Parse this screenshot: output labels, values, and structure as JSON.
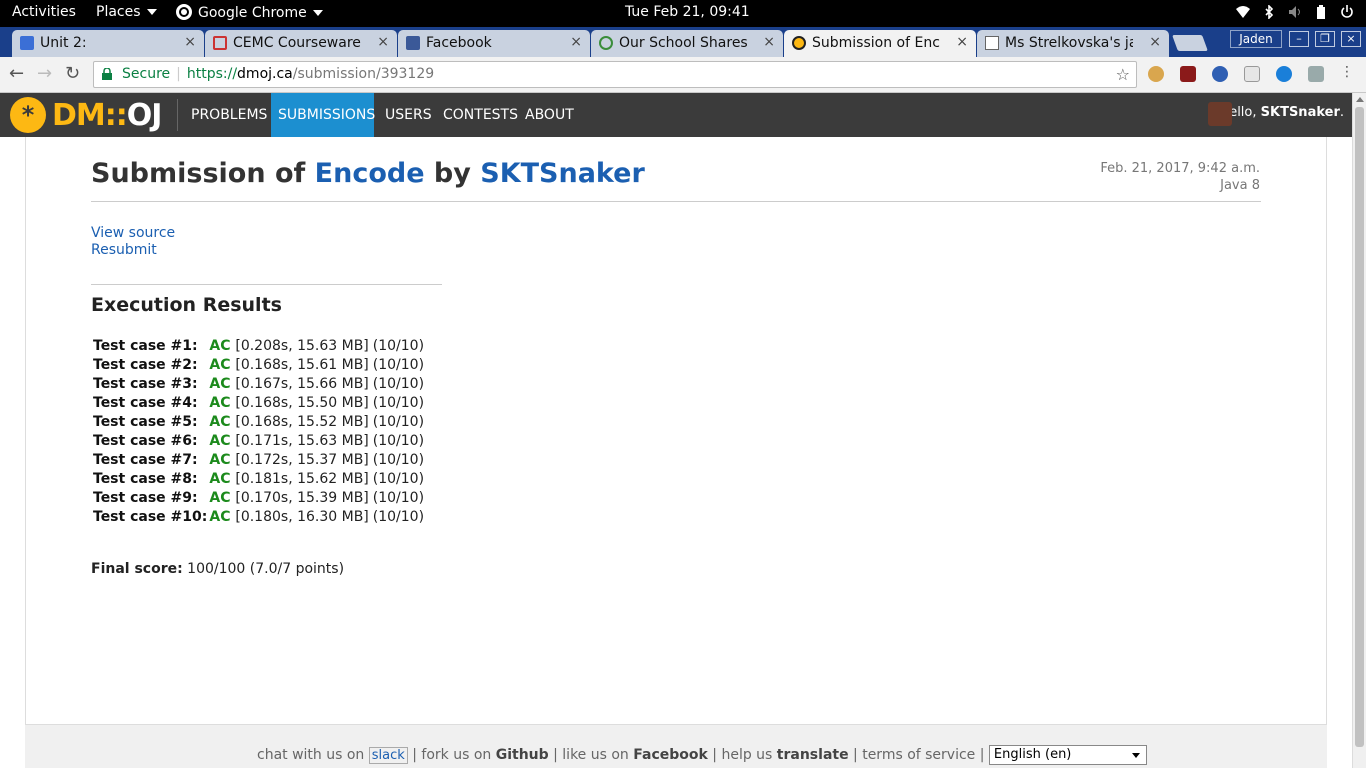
{
  "system_bar": {
    "activities": "Activities",
    "places": "Places",
    "app": "Google Chrome",
    "clock": "Tue Feb 21, 09:41"
  },
  "browser": {
    "tabs": [
      {
        "title": "Unit 2:"
      },
      {
        "title": "CEMC Courseware - M"
      },
      {
        "title": "Facebook"
      },
      {
        "title": "Our School Shares"
      },
      {
        "title": "Submission of Encode"
      },
      {
        "title": "Ms Strelkovska's java"
      }
    ],
    "profile": "Jaden",
    "security_label": "Secure",
    "url_scheme": "https://",
    "url_host": "dmoj.ca",
    "url_path": "/submission/393129"
  },
  "site": {
    "logo_dm": "DM",
    "logo_sep": "::",
    "logo_oj": "OJ",
    "nav": [
      "PROBLEMS",
      "SUBMISSIONS",
      "USERS",
      "CONTESTS",
      "ABOUT"
    ],
    "greeting_prefix": "Hello, ",
    "username": "SKTSnaker",
    "greeting_suffix": "."
  },
  "submission": {
    "title_prefix": "Submission of ",
    "problem": "Encode",
    "title_by": " by ",
    "author": "SKTSnaker",
    "date": "Feb. 21, 2017, 9:42 a.m.",
    "language": "Java 8",
    "view_source": "View source",
    "resubmit": "Resubmit",
    "execution_title": "Execution Results",
    "test_cases": [
      {
        "label": "Test case #1:",
        "status": "AC",
        "resources": "[0.208s, 15.63 MB]",
        "points": "(10/10)"
      },
      {
        "label": "Test case #2:",
        "status": "AC",
        "resources": "[0.168s, 15.61 MB]",
        "points": "(10/10)"
      },
      {
        "label": "Test case #3:",
        "status": "AC",
        "resources": "[0.167s, 15.66 MB]",
        "points": "(10/10)"
      },
      {
        "label": "Test case #4:",
        "status": "AC",
        "resources": "[0.168s, 15.50 MB]",
        "points": "(10/10)"
      },
      {
        "label": "Test case #5:",
        "status": "AC",
        "resources": "[0.168s, 15.52 MB]",
        "points": "(10/10)"
      },
      {
        "label": "Test case #6:",
        "status": "AC",
        "resources": "[0.171s, 15.63 MB]",
        "points": "(10/10)"
      },
      {
        "label": "Test case #7:",
        "status": "AC",
        "resources": "[0.172s, 15.37 MB]",
        "points": "(10/10)"
      },
      {
        "label": "Test case #8:",
        "status": "AC",
        "resources": "[0.181s, 15.62 MB]",
        "points": "(10/10)"
      },
      {
        "label": "Test case #9:",
        "status": "AC",
        "resources": "[0.170s, 15.39 MB]",
        "points": "(10/10)"
      },
      {
        "label": "Test case #10:",
        "status": "AC",
        "resources": "[0.180s, 16.30 MB]",
        "points": "(10/10)"
      }
    ],
    "final_label": "Final score:",
    "final_value": "100/100 (7.0/7 points)"
  },
  "footer": {
    "chat_prefix": "chat with us on",
    "slack_alt": "slack",
    "fork_prefix": "fork us on",
    "github": "Github",
    "like_prefix": "like us on",
    "facebook": "Facebook",
    "help_prefix": "help us",
    "translate": "translate",
    "terms": "terms of service",
    "language_selected": "English (en)"
  },
  "colors": {
    "nav_bg": "#3b3b3b",
    "nav_active": "#1c8fd0",
    "logo_yellow": "#fdb813",
    "link_blue": "#1b5fb1",
    "ac_green": "#1c8a1c",
    "tabstrip": "#1a3f8a"
  },
  "icons": [
    "chrome-icon",
    "wifi-icon",
    "bluetooth-icon",
    "volume-icon",
    "battery-icon",
    "power-icon",
    "back-icon",
    "forward-icon",
    "reload-icon",
    "lock-icon",
    "star-icon"
  ]
}
